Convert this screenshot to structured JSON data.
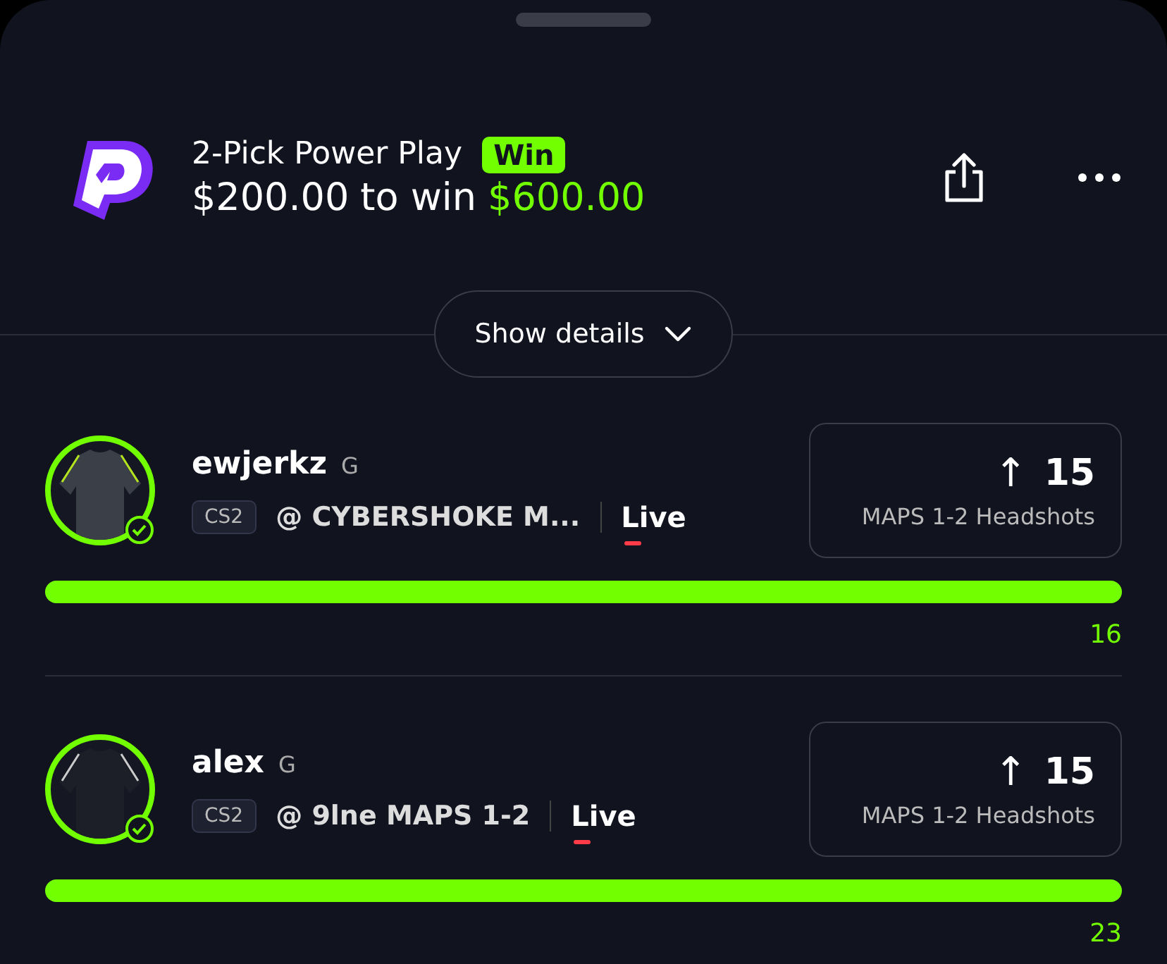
{
  "header": {
    "title": "2-Pick Power Play",
    "result_badge": "Win",
    "won": true,
    "stake": "$200.00",
    "connector": "to win",
    "payout": "$600.00"
  },
  "details_button": {
    "label": "Show details",
    "expanded": false
  },
  "picks": [
    {
      "name": "ewjerkz",
      "position": "G",
      "league": "CS2",
      "matchup": "@ CYBERSHOKE M...",
      "status": "Live",
      "arrow": "↑",
      "line": "15",
      "stat": "MAPS 1-2 Headshots",
      "level": 1,
      "actual": "16",
      "hit": true
    },
    {
      "name": "alex",
      "position": "G",
      "league": "CS2",
      "matchup": "@ 9lne MAPS 1-2",
      "status": "Live",
      "arrow": "↑",
      "line": "15",
      "stat": "MAPS 1-2 Headshots",
      "level": 1,
      "actual": "23",
      "hit": true
    }
  ]
}
